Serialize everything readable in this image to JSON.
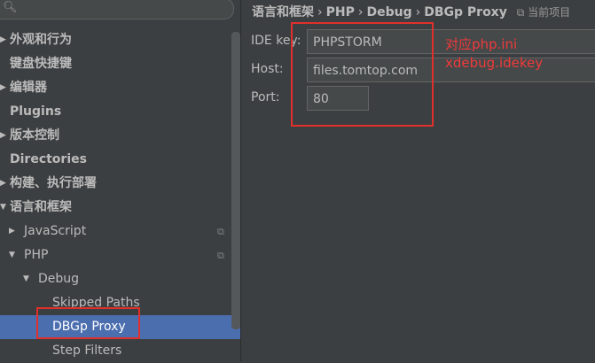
{
  "search": {
    "icon": "search-icon",
    "value": ""
  },
  "tree": {
    "items": [
      {
        "label": "外观和行为",
        "bold": true,
        "arrow": "right"
      },
      {
        "label": "键盘快捷键",
        "bold": true,
        "arrow": ""
      },
      {
        "label": "编辑器",
        "bold": true,
        "arrow": "right"
      },
      {
        "label": "Plugins",
        "bold": true,
        "arrow": ""
      },
      {
        "label": "版本控制",
        "bold": true,
        "arrow": "right"
      },
      {
        "label": "Directories",
        "bold": true,
        "arrow": ""
      },
      {
        "label": "构建、执行部署",
        "bold": true,
        "arrow": "right"
      },
      {
        "label": "语言和框架",
        "bold": true,
        "arrow": "down"
      },
      {
        "label": "JavaScript",
        "bold": false,
        "arrow": "right"
      },
      {
        "label": "PHP",
        "bold": false,
        "arrow": "down"
      },
      {
        "label": "Debug",
        "bold": false,
        "arrow": "down"
      },
      {
        "label": "Skipped Paths",
        "bold": false,
        "arrow": ""
      },
      {
        "label": "DBGp Proxy",
        "bold": false,
        "arrow": "",
        "selected": true
      },
      {
        "label": "Step Filters",
        "bold": false,
        "arrow": ""
      }
    ]
  },
  "breadcrumb": {
    "parts": [
      "语言和框架",
      "PHP",
      "Debug",
      "DBGp Proxy"
    ],
    "separator": "›",
    "scope": "当前项目"
  },
  "form": {
    "ide_key_label": "IDE key:",
    "ide_key_value": "PHPSTORM",
    "host_label": "Host:",
    "host_value": "files.tomtop.com",
    "port_label": "Port:",
    "port_value": "80"
  },
  "annotation": {
    "line1": "对应php.ini",
    "line2": "xdebug.idekey",
    "color": "#e0302b"
  }
}
